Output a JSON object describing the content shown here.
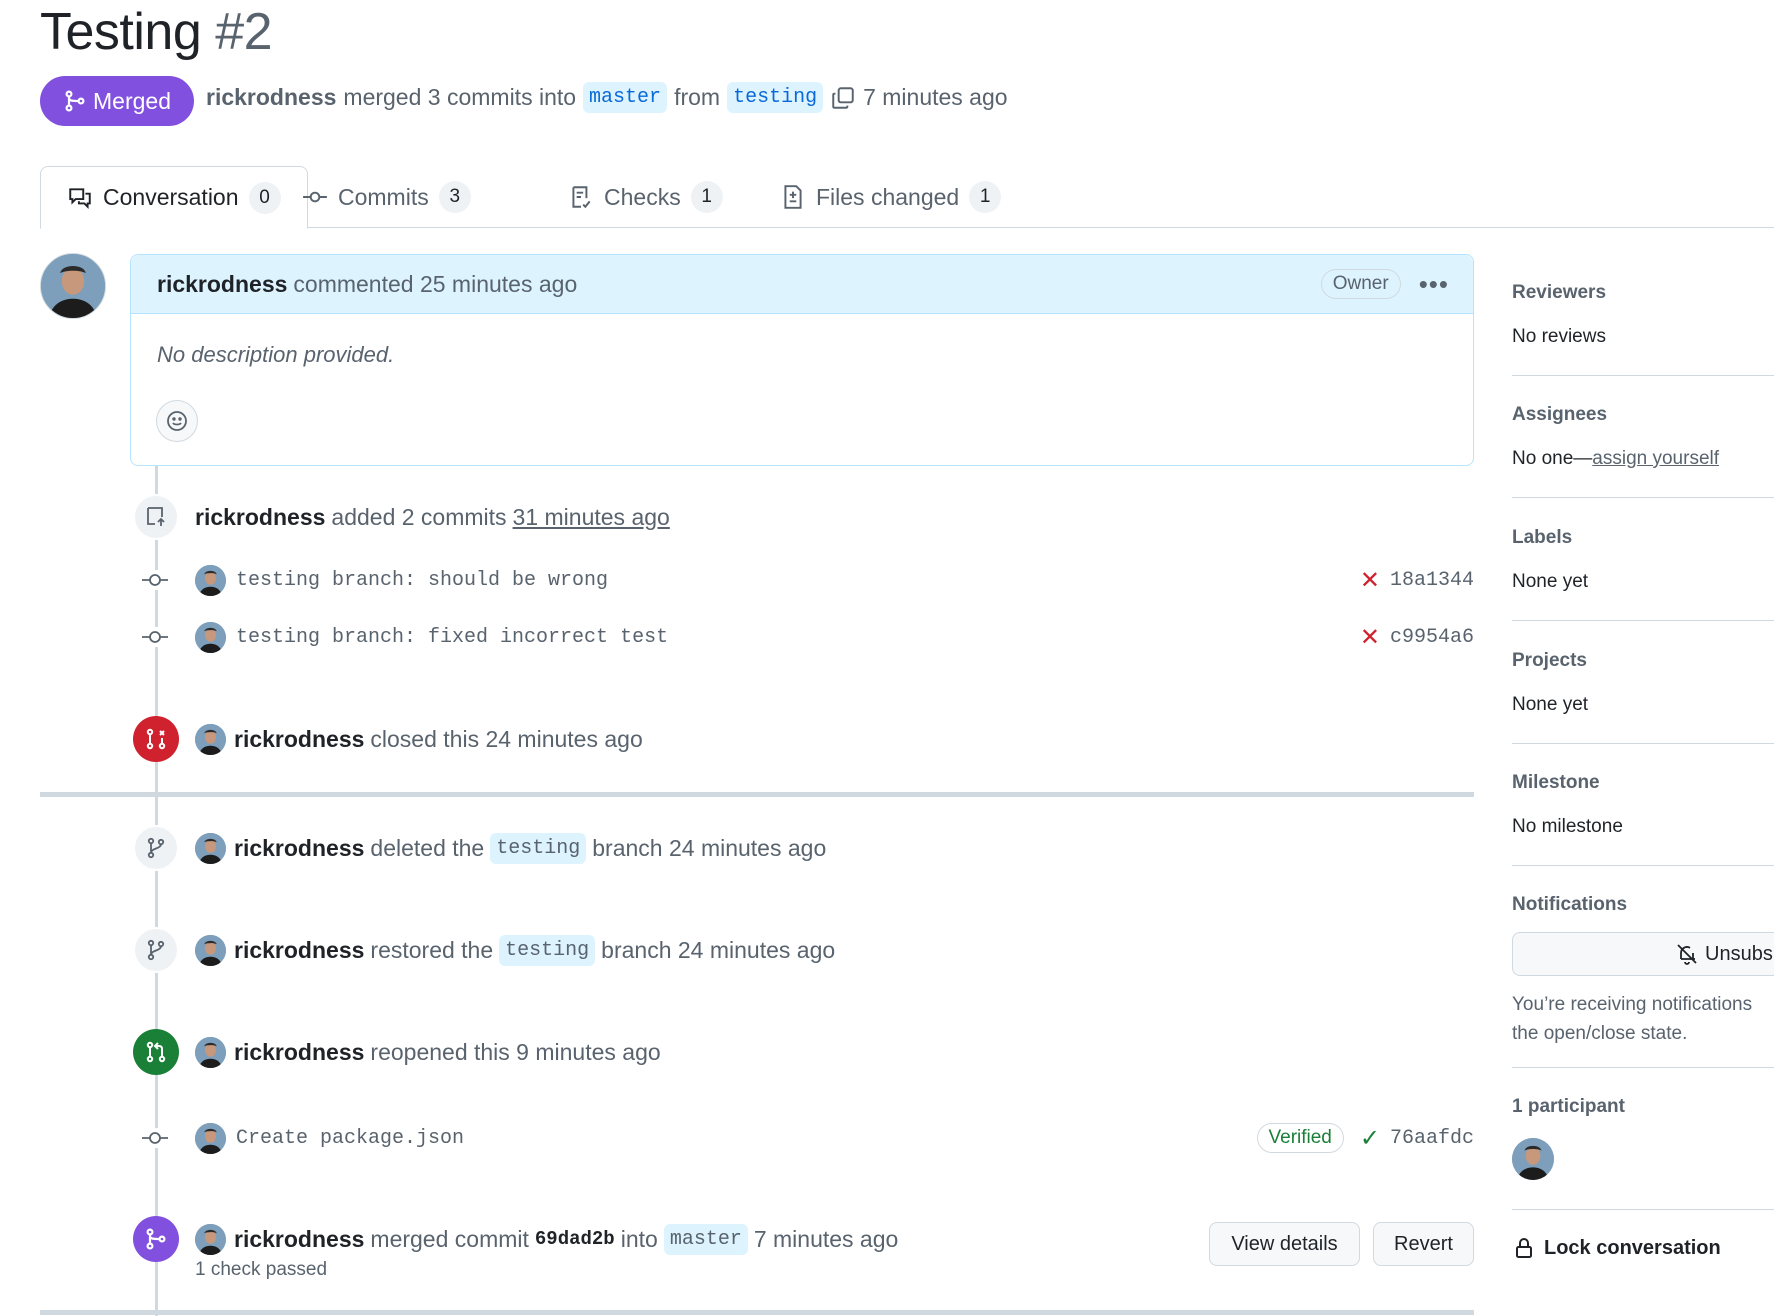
{
  "pr": {
    "title": "Testing",
    "number": "#2",
    "state": "Merged",
    "author": "rickrodness",
    "meta_text": "merged 3 commits into",
    "base": "master",
    "from_text": "from",
    "head": "testing",
    "time": "7 minutes ago"
  },
  "tabs": [
    {
      "label": "Conversation",
      "count": "0"
    },
    {
      "label": "Commits",
      "count": "3"
    },
    {
      "label": "Checks",
      "count": "1"
    },
    {
      "label": "Files changed",
      "count": "1"
    }
  ],
  "comment": {
    "user": "rickrodness",
    "action": "commented 25 minutes ago",
    "badge": "Owner",
    "menu": "•••",
    "body": "No description provided."
  },
  "timeline": {
    "added": {
      "user": "rickrodness",
      "text": "added 2 commits",
      "time": "31 minutes ago"
    },
    "commits_1": [
      {
        "msg": "testing branch: should be wrong",
        "status": "✕",
        "sha": "18a1344"
      },
      {
        "msg": "testing branch: fixed incorrect test",
        "status": "✕",
        "sha": "c9954a6"
      }
    ],
    "closed": {
      "user": "rickrodness",
      "text": "closed this 24 minutes ago"
    },
    "deleted": {
      "user": "rickrodness",
      "pre": "deleted the",
      "branch": "testing",
      "post": "branch 24 minutes ago"
    },
    "restored": {
      "user": "rickrodness",
      "pre": "restored the",
      "branch": "testing",
      "post": "branch 24 minutes ago"
    },
    "reopened": {
      "user": "rickrodness",
      "text": "reopened this 9 minutes ago"
    },
    "commit_2": {
      "msg": "Create package.json",
      "verified": "Verified",
      "status": "✓",
      "sha": "76aafdc"
    },
    "merged": {
      "user": "rickrodness",
      "pre": "merged commit",
      "sha": "69dad2b",
      "into": "into",
      "branch": "master",
      "time": "7 minutes ago",
      "checks": "1 check passed",
      "view_details": "View details",
      "revert": "Revert"
    }
  },
  "sidebar": {
    "reviewers": {
      "title": "Reviewers",
      "value": "No reviews"
    },
    "assignees": {
      "title": "Assignees",
      "value": "No one—",
      "link": "assign yourself"
    },
    "labels": {
      "title": "Labels",
      "value": "None yet"
    },
    "projects": {
      "title": "Projects",
      "value": "None yet"
    },
    "milestone": {
      "title": "Milestone",
      "value": "No milestone"
    },
    "notifications": {
      "title": "Notifications",
      "button": "Unsubs",
      "note_1": "You’re receiving notifications",
      "note_2": "the open/close state."
    },
    "participants": {
      "title": "1 participant"
    },
    "lock": "Lock conversation"
  },
  "colors": {
    "merged_purple": "#8250df",
    "closed_red": "#cf222e",
    "open_green": "#1a7f37",
    "branch_bg": "#ddf4ff",
    "link_blue": "#0969da"
  }
}
